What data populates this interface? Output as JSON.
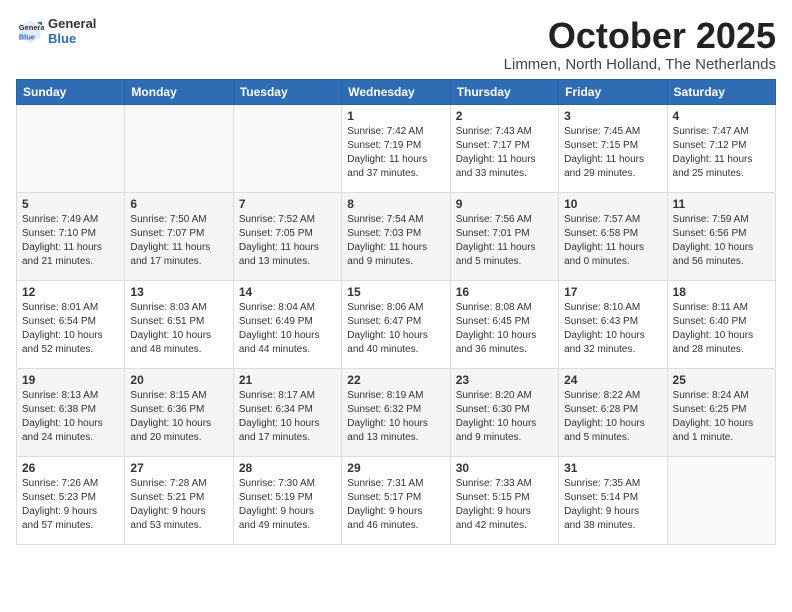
{
  "header": {
    "logo_general": "General",
    "logo_blue": "Blue",
    "month_title": "October 2025",
    "location": "Limmen, North Holland, The Netherlands"
  },
  "days_of_week": [
    "Sunday",
    "Monday",
    "Tuesday",
    "Wednesday",
    "Thursday",
    "Friday",
    "Saturday"
  ],
  "weeks": [
    [
      {
        "day": "",
        "info": ""
      },
      {
        "day": "",
        "info": ""
      },
      {
        "day": "",
        "info": ""
      },
      {
        "day": "1",
        "info": "Sunrise: 7:42 AM\nSunset: 7:19 PM\nDaylight: 11 hours\nand 37 minutes."
      },
      {
        "day": "2",
        "info": "Sunrise: 7:43 AM\nSunset: 7:17 PM\nDaylight: 11 hours\nand 33 minutes."
      },
      {
        "day": "3",
        "info": "Sunrise: 7:45 AM\nSunset: 7:15 PM\nDaylight: 11 hours\nand 29 minutes."
      },
      {
        "day": "4",
        "info": "Sunrise: 7:47 AM\nSunset: 7:12 PM\nDaylight: 11 hours\nand 25 minutes."
      }
    ],
    [
      {
        "day": "5",
        "info": "Sunrise: 7:49 AM\nSunset: 7:10 PM\nDaylight: 11 hours\nand 21 minutes."
      },
      {
        "day": "6",
        "info": "Sunrise: 7:50 AM\nSunset: 7:07 PM\nDaylight: 11 hours\nand 17 minutes."
      },
      {
        "day": "7",
        "info": "Sunrise: 7:52 AM\nSunset: 7:05 PM\nDaylight: 11 hours\nand 13 minutes."
      },
      {
        "day": "8",
        "info": "Sunrise: 7:54 AM\nSunset: 7:03 PM\nDaylight: 11 hours\nand 9 minutes."
      },
      {
        "day": "9",
        "info": "Sunrise: 7:56 AM\nSunset: 7:01 PM\nDaylight: 11 hours\nand 5 minutes."
      },
      {
        "day": "10",
        "info": "Sunrise: 7:57 AM\nSunset: 6:58 PM\nDaylight: 11 hours\nand 0 minutes."
      },
      {
        "day": "11",
        "info": "Sunrise: 7:59 AM\nSunset: 6:56 PM\nDaylight: 10 hours\nand 56 minutes."
      }
    ],
    [
      {
        "day": "12",
        "info": "Sunrise: 8:01 AM\nSunset: 6:54 PM\nDaylight: 10 hours\nand 52 minutes."
      },
      {
        "day": "13",
        "info": "Sunrise: 8:03 AM\nSunset: 6:51 PM\nDaylight: 10 hours\nand 48 minutes."
      },
      {
        "day": "14",
        "info": "Sunrise: 8:04 AM\nSunset: 6:49 PM\nDaylight: 10 hours\nand 44 minutes."
      },
      {
        "day": "15",
        "info": "Sunrise: 8:06 AM\nSunset: 6:47 PM\nDaylight: 10 hours\nand 40 minutes."
      },
      {
        "day": "16",
        "info": "Sunrise: 8:08 AM\nSunset: 6:45 PM\nDaylight: 10 hours\nand 36 minutes."
      },
      {
        "day": "17",
        "info": "Sunrise: 8:10 AM\nSunset: 6:43 PM\nDaylight: 10 hours\nand 32 minutes."
      },
      {
        "day": "18",
        "info": "Sunrise: 8:11 AM\nSunset: 6:40 PM\nDaylight: 10 hours\nand 28 minutes."
      }
    ],
    [
      {
        "day": "19",
        "info": "Sunrise: 8:13 AM\nSunset: 6:38 PM\nDaylight: 10 hours\nand 24 minutes."
      },
      {
        "day": "20",
        "info": "Sunrise: 8:15 AM\nSunset: 6:36 PM\nDaylight: 10 hours\nand 20 minutes."
      },
      {
        "day": "21",
        "info": "Sunrise: 8:17 AM\nSunset: 6:34 PM\nDaylight: 10 hours\nand 17 minutes."
      },
      {
        "day": "22",
        "info": "Sunrise: 8:19 AM\nSunset: 6:32 PM\nDaylight: 10 hours\nand 13 minutes."
      },
      {
        "day": "23",
        "info": "Sunrise: 8:20 AM\nSunset: 6:30 PM\nDaylight: 10 hours\nand 9 minutes."
      },
      {
        "day": "24",
        "info": "Sunrise: 8:22 AM\nSunset: 6:28 PM\nDaylight: 10 hours\nand 5 minutes."
      },
      {
        "day": "25",
        "info": "Sunrise: 8:24 AM\nSunset: 6:25 PM\nDaylight: 10 hours\nand 1 minute."
      }
    ],
    [
      {
        "day": "26",
        "info": "Sunrise: 7:26 AM\nSunset: 5:23 PM\nDaylight: 9 hours\nand 57 minutes."
      },
      {
        "day": "27",
        "info": "Sunrise: 7:28 AM\nSunset: 5:21 PM\nDaylight: 9 hours\nand 53 minutes."
      },
      {
        "day": "28",
        "info": "Sunrise: 7:30 AM\nSunset: 5:19 PM\nDaylight: 9 hours\nand 49 minutes."
      },
      {
        "day": "29",
        "info": "Sunrise: 7:31 AM\nSunset: 5:17 PM\nDaylight: 9 hours\nand 46 minutes."
      },
      {
        "day": "30",
        "info": "Sunrise: 7:33 AM\nSunset: 5:15 PM\nDaylight: 9 hours\nand 42 minutes."
      },
      {
        "day": "31",
        "info": "Sunrise: 7:35 AM\nSunset: 5:14 PM\nDaylight: 9 hours\nand 38 minutes."
      },
      {
        "day": "",
        "info": ""
      }
    ]
  ]
}
